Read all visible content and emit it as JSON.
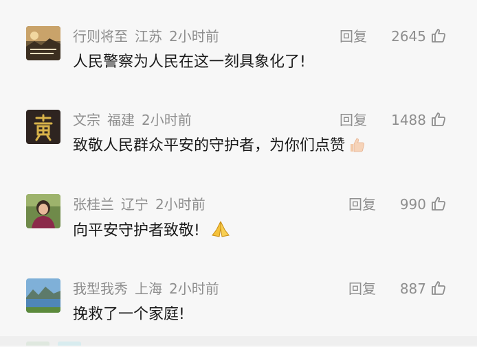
{
  "comments": [
    {
      "user": "行则将至",
      "region": "江苏",
      "time": "2小时前",
      "reply_label": "回复",
      "likes": "2645",
      "text": "人民警察为人民在这一刻具象化了!",
      "avatar_icon": "landscape-photo-avatar"
    },
    {
      "user": "文宗",
      "region": "福建",
      "time": "2小时前",
      "reply_label": "回复",
      "likes": "1488",
      "text": "致敬人民群众平安的守护者，为你们点赞",
      "emoji": "thumbs-up-emoji",
      "avatar_icon": "calligraphy-avatar"
    },
    {
      "user": "张桂兰",
      "region": "辽宁",
      "time": "2小时前",
      "reply_label": "回复",
      "likes": "990",
      "text": "向平安守护者致敬!",
      "emoji": "folded-hands-emoji",
      "avatar_icon": "portrait-avatar"
    },
    {
      "user": "我型我秀",
      "region": "上海",
      "time": "2小时前",
      "reply_label": "回复",
      "likes": "887",
      "text": "挽救了一个家庭!",
      "avatar_icon": "lake-landscape-avatar"
    }
  ],
  "colors": {
    "background": "#f7f7f7",
    "meta_text": "#8e8e8e",
    "comment_text": "#1a1a1a"
  }
}
